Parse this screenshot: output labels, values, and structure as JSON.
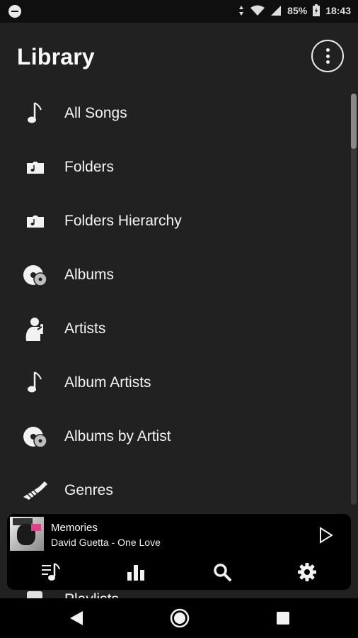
{
  "status_bar": {
    "battery": "85%",
    "time": "18:43"
  },
  "header": {
    "title": "Library"
  },
  "library_items": [
    {
      "label": "All Songs",
      "icon": "music-note-icon"
    },
    {
      "label": "Folders",
      "icon": "folder-music-icon"
    },
    {
      "label": "Folders Hierarchy",
      "icon": "folder-music-icon"
    },
    {
      "label": "Albums",
      "icon": "album-disc-icon"
    },
    {
      "label": "Artists",
      "icon": "singer-icon"
    },
    {
      "label": "Album Artists",
      "icon": "music-note-icon"
    },
    {
      "label": "Albums by Artist",
      "icon": "album-disc-icon"
    },
    {
      "label": "Genres",
      "icon": "trumpet-icon"
    },
    {
      "label": "Playlists",
      "icon": "playlist-icon"
    }
  ],
  "now_playing": {
    "title": "Memories",
    "artist_album": "David Guetta - One Love"
  },
  "bottom_tabs": [
    "queue-icon",
    "equalizer-icon",
    "search-icon",
    "settings-icon"
  ],
  "nav_bar": [
    "back-icon",
    "home-icon",
    "recents-icon"
  ]
}
